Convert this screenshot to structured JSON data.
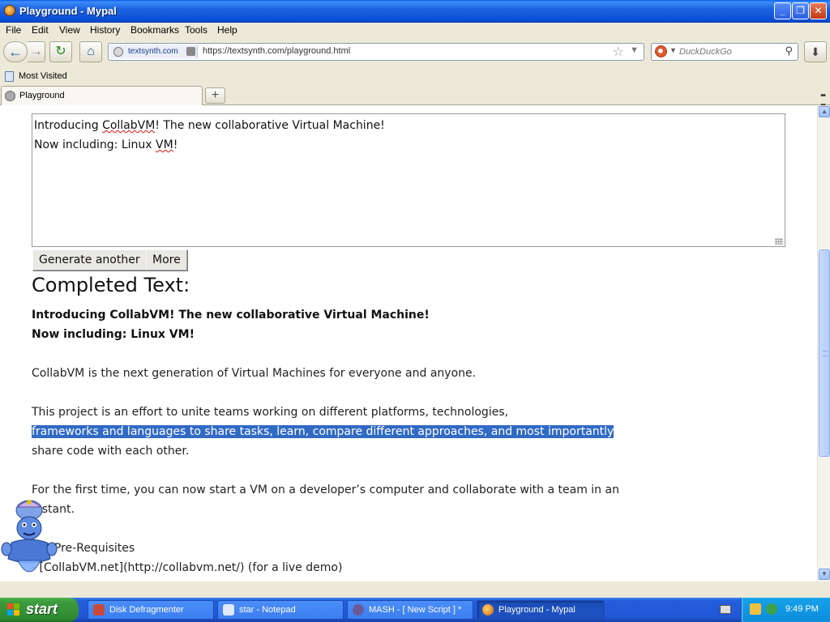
{
  "window": {
    "title": "Playground - Mypal"
  },
  "menu": [
    "File",
    "Edit",
    "View",
    "History",
    "Bookmarks",
    "Tools",
    "Help"
  ],
  "navbar": {
    "site_domain": "textsynth.com",
    "url": "https://textsynth.com/playground.html",
    "search_placeholder": "DuckDuckGo"
  },
  "bookmarks": {
    "item": "Most Visited"
  },
  "tabs": [
    {
      "label": "Playground"
    }
  ],
  "page": {
    "prompt_lines": [
      "Introducing CollabVM! The new collaborative Virtual Machine!",
      "Now including: Linux VM!"
    ],
    "buttons": {
      "generate": "Generate another",
      "more": "More"
    },
    "completed_title": "Completed Text:",
    "output": {
      "bold_line1": "Introducing CollabVM! The new collaborative Virtual Machine!",
      "bold_line2": "Now including: Linux VM!",
      "p1": "CollabVM is the next generation of Virtual Machines for everyone and anyone.",
      "p2_line1": "This project is an effort to unite teams working on different platforms, technologies,",
      "p2_line2": "frameworks and languages to share tasks, learn, compare different approaches, and most importantly",
      "p2_line3": "share code with each other.",
      "p3_line1": "For the first time, you can now start a VM on a developer’s computer and collaborate with a team in an",
      "p3_line2": "instant.",
      "p4_line1": "## Pre-Requisites",
      "p4_line2": "- [CollabVM.net](http://collabvm.net/) (for a live demo)"
    }
  },
  "taskbar": {
    "start": "start",
    "tasks": [
      "Disk Defragmenter",
      "star - Notepad",
      "MASH - [ New Script ] *",
      "Playground - Mypal"
    ],
    "clock": "9:49 PM"
  },
  "colors": {
    "selection": "#316ac5",
    "titlebar": "#0a4fd4",
    "taskbar": "#245edb",
    "start": "#3c9a3c"
  }
}
